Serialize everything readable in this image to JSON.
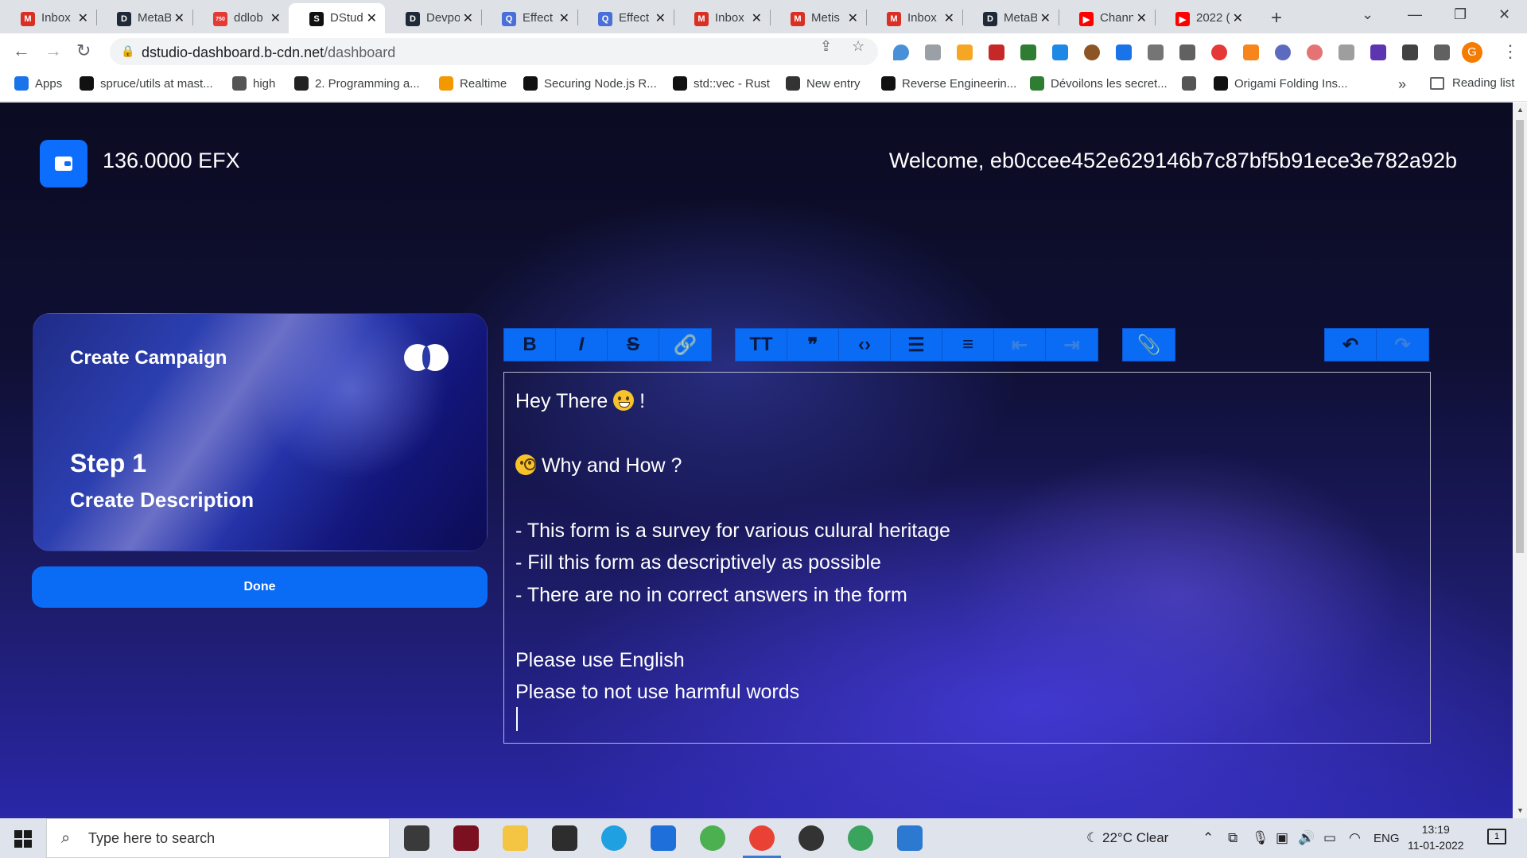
{
  "browser": {
    "tabs": [
      {
        "title": "Inbox",
        "icon": "gmail-icon",
        "color": "#d93025",
        "glyph": "M"
      },
      {
        "title": "MetaB",
        "icon": "metabase-icon",
        "color": "#1f2937",
        "glyph": "D"
      },
      {
        "title": "ddlob",
        "icon": "badge-icon",
        "color": "#e53935",
        "glyph": "750"
      },
      {
        "title": "DStud",
        "icon": "dstudio-icon",
        "color": "#111111",
        "glyph": "S",
        "active": true
      },
      {
        "title": "Devpo",
        "icon": "devpost-icon",
        "color": "#1f2937",
        "glyph": "D"
      },
      {
        "title": "Effect",
        "icon": "effect-icon",
        "color": "#4a6fd8",
        "glyph": "Q"
      },
      {
        "title": "Effect",
        "icon": "effect-icon",
        "color": "#4a6fd8",
        "glyph": "Q"
      },
      {
        "title": "Inbox",
        "icon": "gmail-icon",
        "color": "#d93025",
        "glyph": "M"
      },
      {
        "title": "Metis",
        "icon": "gmail-icon",
        "color": "#d93025",
        "glyph": "M"
      },
      {
        "title": "Inbox",
        "icon": "gmail-icon",
        "color": "#d93025",
        "glyph": "M"
      },
      {
        "title": "MetaB",
        "icon": "metabase-icon",
        "color": "#1f2937",
        "glyph": "D"
      },
      {
        "title": "Chann",
        "icon": "youtube-icon",
        "color": "#ff0000",
        "glyph": "▶"
      },
      {
        "title": "2022 (",
        "icon": "youtube-icon",
        "color": "#ff0000",
        "glyph": "▶"
      }
    ],
    "url_host": "dstudio-dashboard.b-cdn.net",
    "url_path": "/dashboard",
    "bookmarks": [
      {
        "label": "Apps",
        "color": "#1a73e8"
      },
      {
        "label": "spruce/utils at mast...",
        "color": "#111111"
      },
      {
        "label": "high",
        "color": "#555555"
      },
      {
        "label": "2. Programming a...",
        "color": "#222222"
      },
      {
        "label": "Realtime",
        "color": "#f29900"
      },
      {
        "label": "Securing Node.js R...",
        "color": "#111111"
      },
      {
        "label": "std::vec - Rust",
        "color": "#111111"
      },
      {
        "label": "New entry",
        "color": "#333333"
      },
      {
        "label": "Reverse Engineerin...",
        "color": "#111111"
      },
      {
        "label": "Dévoilons les secret...",
        "color": "#2e7d32"
      },
      {
        "label": "",
        "color": "#555555"
      },
      {
        "label": "Origami Folding Ins...",
        "color": "#111111"
      }
    ],
    "reading_list": "Reading list",
    "profile_initial": "G"
  },
  "header": {
    "balance": "136.0000 EFX",
    "welcome": "Welcome, eb0ccee452e629146b7c87bf5b91ece3e782a92b"
  },
  "card": {
    "title": "Create Campaign",
    "step": "Step 1",
    "subtitle": "Create Description"
  },
  "done_label": "Done",
  "editor_toolbar": {
    "format": [
      {
        "name": "bold-button",
        "glyph": "B"
      },
      {
        "name": "italic-button",
        "glyph": "I"
      },
      {
        "name": "strikethrough-button",
        "glyph": "S"
      },
      {
        "name": "link-button",
        "glyph": "🔗"
      }
    ],
    "blocks": [
      {
        "name": "heading-button",
        "glyph": "TT"
      },
      {
        "name": "quote-button",
        "glyph": "❞"
      },
      {
        "name": "code-button",
        "glyph": "‹›"
      },
      {
        "name": "bullet-list-button",
        "glyph": "☰"
      },
      {
        "name": "number-list-button",
        "glyph": "≡"
      },
      {
        "name": "decrease-indent-button",
        "glyph": "⇤"
      },
      {
        "name": "increase-indent-button",
        "glyph": "⇥"
      }
    ],
    "attach": {
      "name": "attach-button",
      "glyph": "📎"
    },
    "history": [
      {
        "name": "undo-button",
        "glyph": "↶"
      },
      {
        "name": "redo-button",
        "glyph": "↷"
      }
    ]
  },
  "editor": {
    "line1": "Hey There",
    "line1_end": "!",
    "line2": "Why and How ?",
    "bullets": [
      "- This form is a survey for various culural heritage",
      "- Fill this form as descriptively as possible",
      "- There are no in correct answers in the form"
    ],
    "line_english": "Please use English",
    "line_harmful": "Please to not use harmful words"
  },
  "taskbar": {
    "search_placeholder": "Type here to search",
    "weather": "22°C  Clear",
    "language": "ENG",
    "time": "13:19",
    "date": "11-01-2022",
    "notifications": "1"
  }
}
